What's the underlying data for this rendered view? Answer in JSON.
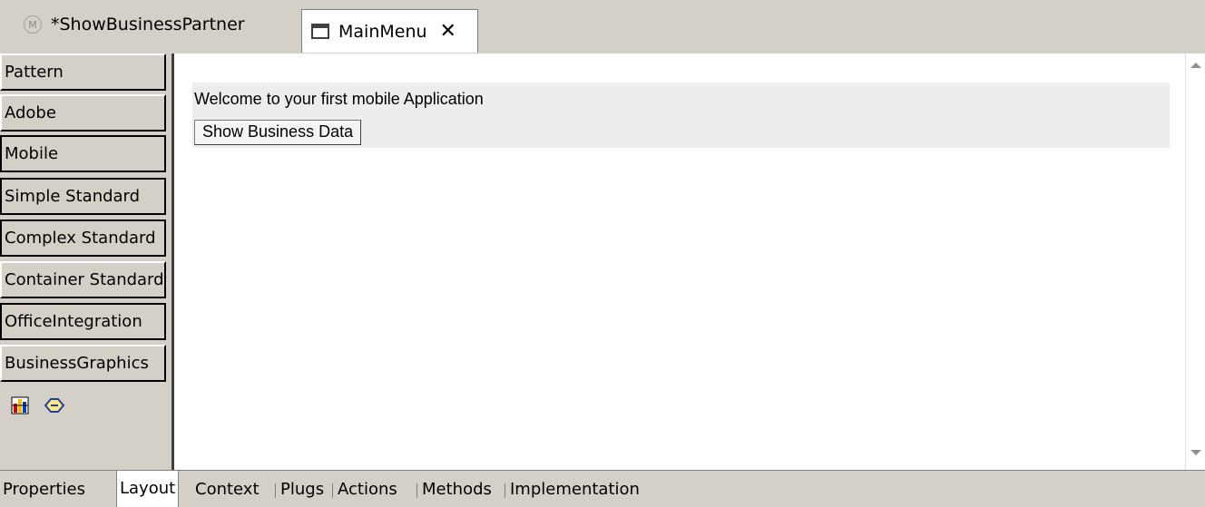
{
  "editor_tabs": [
    {
      "label": "*ShowBusinessPartner",
      "icon": "model-icon",
      "active": false
    },
    {
      "label": "MainMenu",
      "icon": "window-icon",
      "active": true
    }
  ],
  "close_symbol": "✕",
  "model_icon_letter": "M",
  "palette": {
    "items": [
      {
        "label": "Pattern"
      },
      {
        "label": "Adobe"
      },
      {
        "label": "Mobile"
      },
      {
        "label": "Simple Standard"
      },
      {
        "label": "Complex Standard"
      },
      {
        "label": "Container Standard"
      },
      {
        "label": "OfficeIntegration"
      },
      {
        "label": "BusinessGraphics"
      }
    ],
    "icons": [
      "bar-chart-icon",
      "hand-pointer-icon"
    ]
  },
  "canvas": {
    "welcome_text": "Welcome to your first mobile Application",
    "button_label": "Show Business Data"
  },
  "bottom_tabs": [
    {
      "label": "Properties",
      "active": false
    },
    {
      "label": "Layout",
      "active": true
    },
    {
      "label": "Context",
      "active": false
    },
    {
      "label": "Plugs",
      "active": false
    },
    {
      "label": "Actions",
      "active": false
    },
    {
      "label": "Methods",
      "active": false
    },
    {
      "label": "Implementation",
      "active": false
    }
  ],
  "colors": {
    "background": "#d4d0c8",
    "canvas": "#ffffff",
    "container": "#ededed"
  }
}
